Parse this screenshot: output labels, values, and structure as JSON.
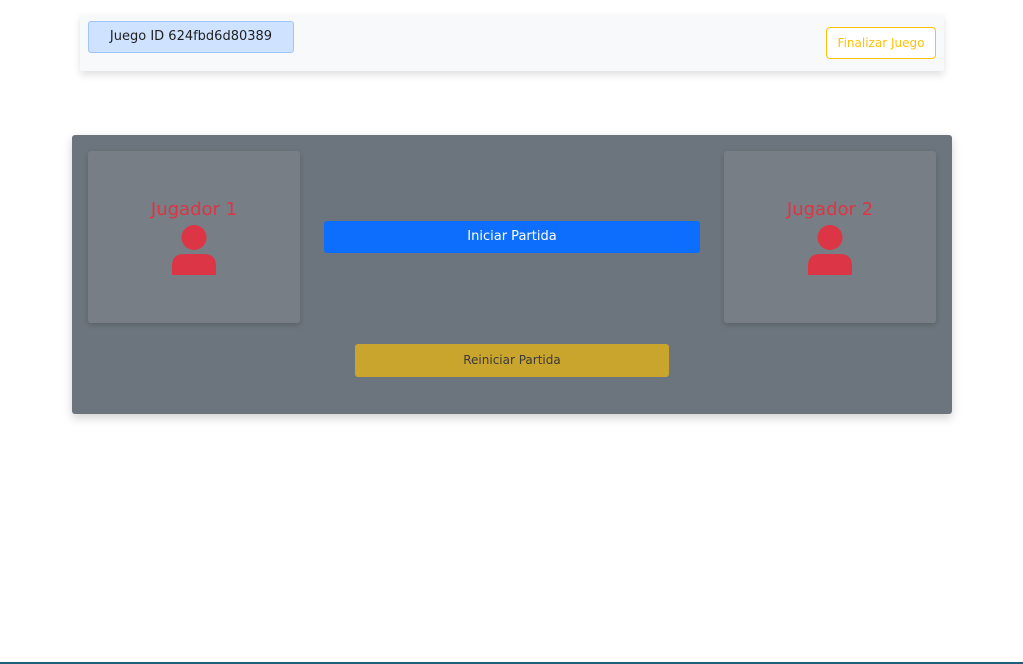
{
  "header": {
    "game_id_label": "Juego ID 624fbd6d80389",
    "finish_button": "Finalizar Juego"
  },
  "board": {
    "players": [
      {
        "name": "Jugador 1",
        "icon": "user-icon"
      },
      {
        "name": "Jugador 2",
        "icon": "user-icon"
      }
    ],
    "start_button": "Iniciar Partida",
    "reset_button": "Reiniciar Partida"
  },
  "colors": {
    "primary": "#0d6efd",
    "warning": "#ffc107",
    "danger": "#dc3545",
    "board_bg": "#6c757d",
    "reset_bg": "#caa52d"
  }
}
